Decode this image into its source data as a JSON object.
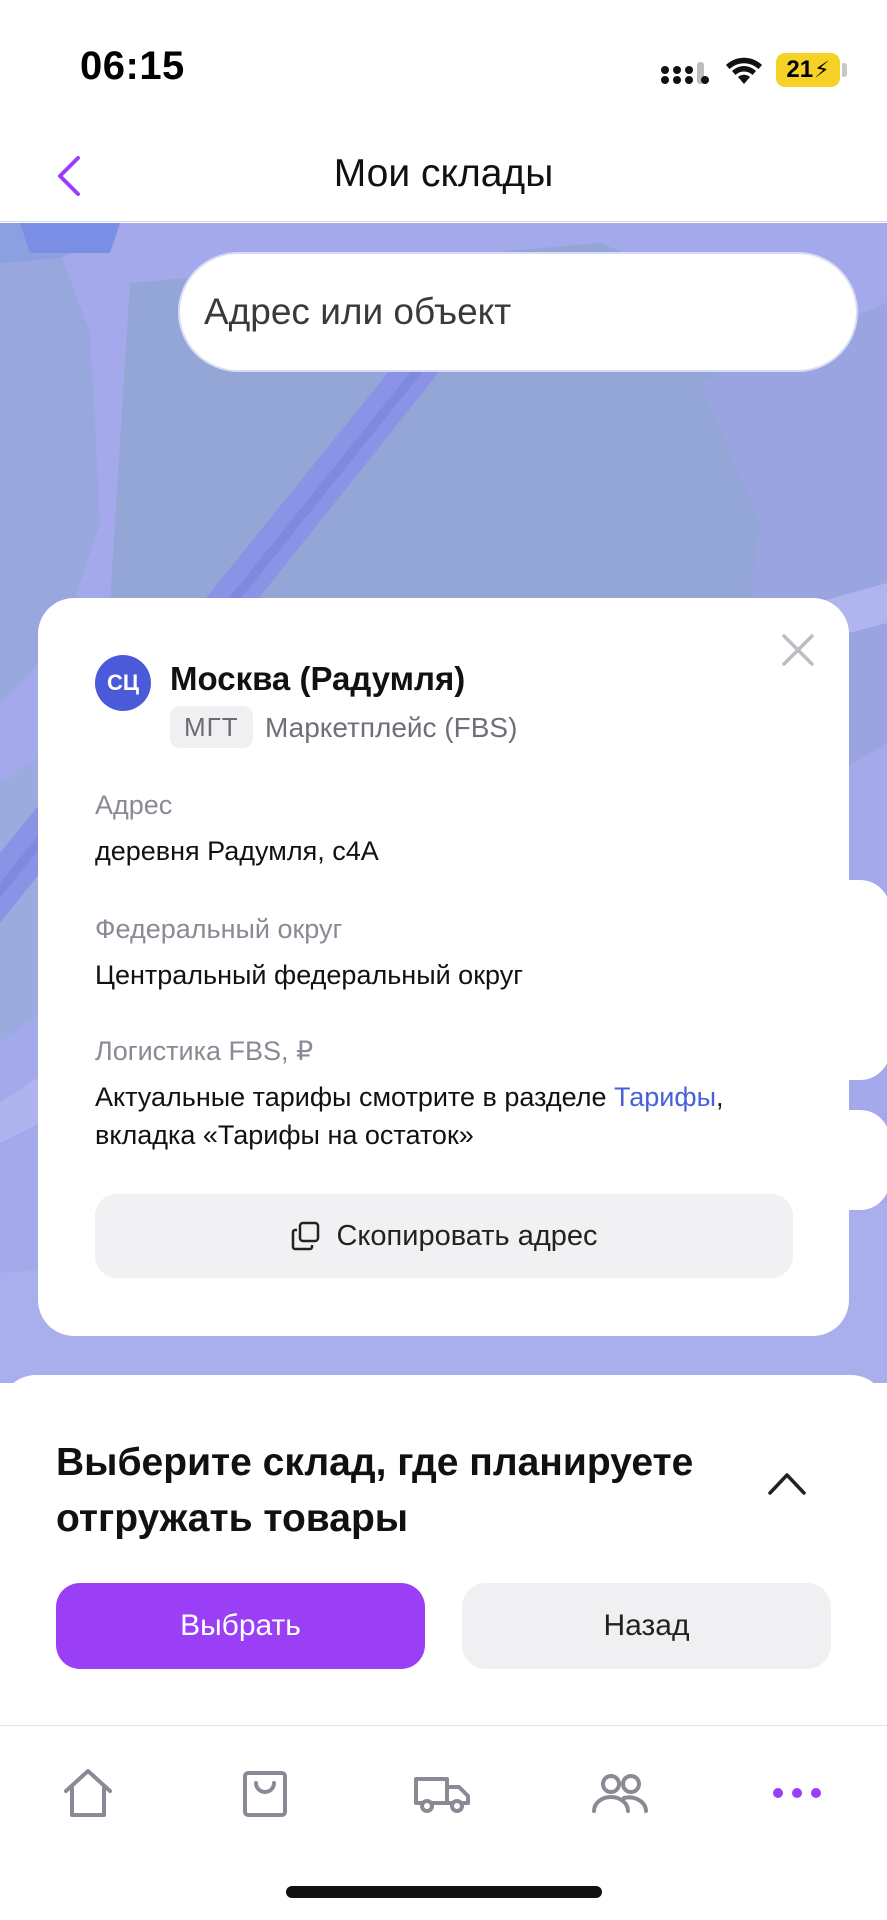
{
  "status_bar": {
    "time": "06:15",
    "battery": "21"
  },
  "nav": {
    "title": "Мои склады",
    "back_icon": "chevron-left-icon"
  },
  "search": {
    "placeholder": "Адрес или объект"
  },
  "warehouse_card": {
    "badge": "СЦ",
    "title": "Москва (Радумля)",
    "tag": "МГТ",
    "type": "Маркетплейс (FBS)",
    "address_label": "Адрес",
    "address_value": "деревня Радумля, с4А",
    "district_label": "Федеральный округ",
    "district_value": "Центральный федеральный округ",
    "logistics_label": "Логистика FBS, ₽",
    "logistics_text_before": "Актуальные тарифы смотрите в разделе ",
    "logistics_link": "Тарифы",
    "logistics_text_after": ",",
    "logistics_text_line2": "вкладка «Тарифы на остаток»",
    "copy_button": "Скопировать адрес"
  },
  "bottom_sheet": {
    "title": "Выберите склад, где планируете отгружать товары",
    "select_button": "Выбрать",
    "back_button": "Назад"
  },
  "tab_bar": {
    "items": [
      {
        "icon": "home-icon"
      },
      {
        "icon": "shopping-bag-icon"
      },
      {
        "icon": "truck-icon"
      },
      {
        "icon": "users-icon"
      },
      {
        "icon": "more-icon"
      }
    ]
  },
  "colors": {
    "accent": "#9b3ff7",
    "map_background": "#a3a9ea",
    "badge_blue": "#4a5ad8",
    "link_blue": "#4660d8"
  }
}
